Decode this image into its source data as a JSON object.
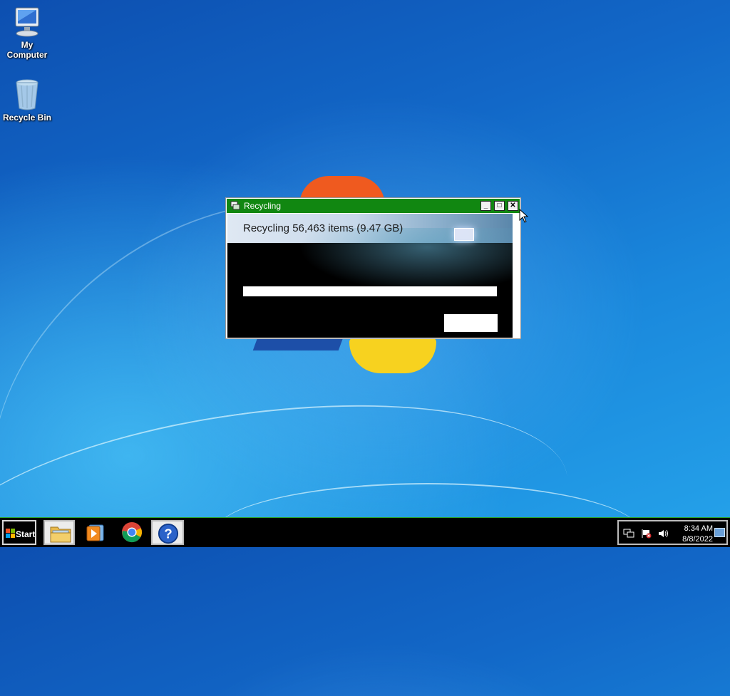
{
  "desktop": {
    "icons": [
      {
        "label": "My Computer",
        "icon": "computer-icon"
      },
      {
        "label": "Recycle Bin",
        "icon": "recycle-bin-icon"
      }
    ]
  },
  "dialog": {
    "title": "Recycling",
    "icon": "recycle-icon",
    "message": "Recycling 56,463 items (9.47 GB)",
    "progress": 0,
    "cancel_label": "",
    "titlebar_color": "#118711"
  },
  "taskbar": {
    "start_label": "Start",
    "apps": [
      {
        "name": "File Explorer",
        "icon": "folder-icon"
      },
      {
        "name": "Windows Media Player",
        "icon": "media-player-icon"
      },
      {
        "name": "Google Chrome",
        "icon": "chrome-icon"
      },
      {
        "name": "Help and Support",
        "icon": "help-icon"
      }
    ],
    "tray": {
      "time": "8:34 AM",
      "date": "8/8/2022"
    },
    "border_color": "#2aa32a"
  }
}
